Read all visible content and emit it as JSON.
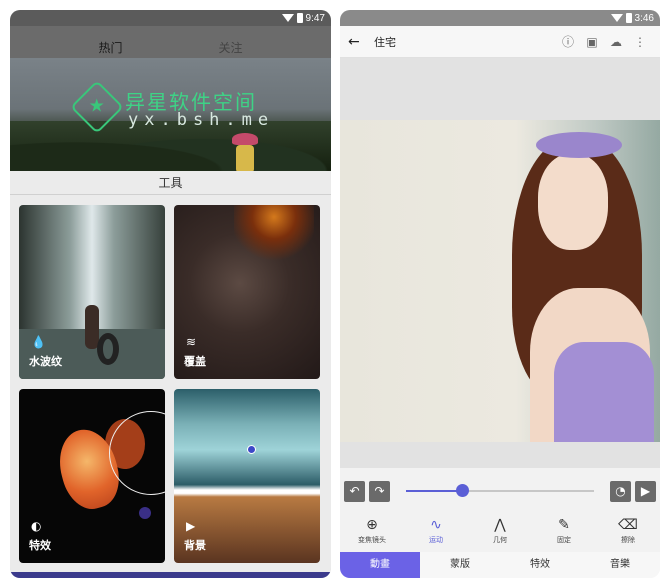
{
  "left": {
    "status_time": "9:47",
    "tabs": [
      "热门",
      "关注"
    ],
    "banner": {
      "brand": "异星软件空间",
      "url": "yx.bsh.me"
    },
    "section_title": "工具",
    "cards": [
      {
        "label": "水波纹",
        "icon": "water-drop-icon"
      },
      {
        "label": "覆盖",
        "icon": "layers-icon"
      },
      {
        "label": "特效",
        "icon": "toggle-icon"
      },
      {
        "label": "背景",
        "icon": "play-icon"
      }
    ]
  },
  "right": {
    "status_time": "3:46",
    "toolbar": {
      "title": "住宅"
    },
    "slider": {
      "value": 0.3
    },
    "tools": [
      {
        "label": "变焦镜头",
        "icon": "zoom-icon"
      },
      {
        "label": "运动",
        "icon": "motion-path-icon"
      },
      {
        "label": "几何",
        "icon": "geometry-icon"
      },
      {
        "label": "固定",
        "icon": "pin-icon"
      },
      {
        "label": "擦除",
        "icon": "eraser-icon"
      }
    ],
    "modes": [
      "動畫",
      "蒙版",
      "特效",
      "音樂"
    ],
    "accent": "#5b5fd6"
  }
}
